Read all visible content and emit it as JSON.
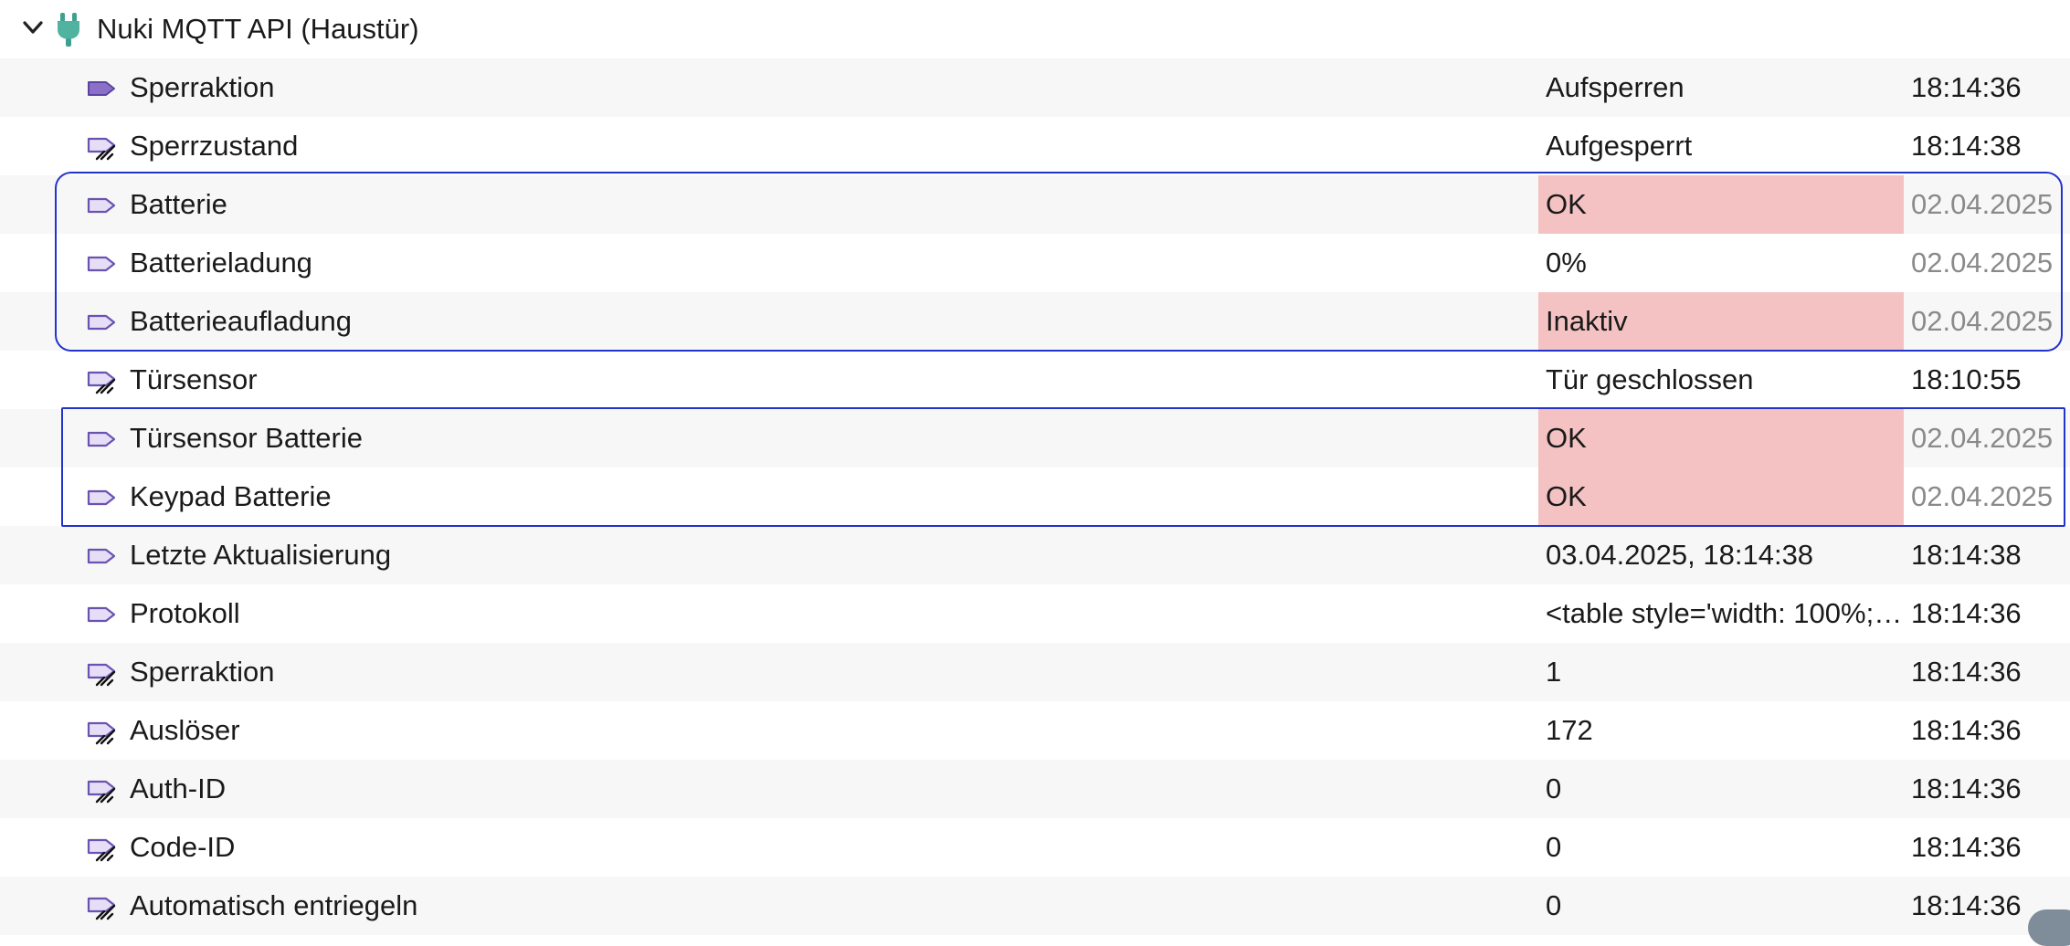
{
  "group": {
    "title": "Nuki MQTT API (Haustür)",
    "expand_icon": "chevron-down-icon",
    "plugin_icon": "plug-icon",
    "plugin_color": "#3fa08f"
  },
  "colors": {
    "row_even": "#f7f7f7",
    "row_odd": "#ffffff",
    "alert_bg": "#f4c2c2",
    "stale_time": "#8a8a8a",
    "highlight_border": "#2233cc",
    "icon_fill": "#8a70c8"
  },
  "rows": [
    {
      "name": "Sperraktion",
      "value": "Aufsperren",
      "time": "18:14:36",
      "icon": "variable-filled-icon",
      "alert": false,
      "stale": false
    },
    {
      "name": "Sperrzustand",
      "value": "Aufgesperrt",
      "time": "18:14:38",
      "icon": "variable-action-icon",
      "alert": false,
      "stale": false
    },
    {
      "name": "Batterie",
      "value": "OK",
      "time": "02.04.2025",
      "icon": "variable-icon",
      "alert": true,
      "stale": true
    },
    {
      "name": "Batterieladung",
      "value": "0%",
      "time": "02.04.2025",
      "icon": "variable-icon",
      "alert": false,
      "stale": true
    },
    {
      "name": "Batterieaufladung",
      "value": "Inaktiv",
      "time": "02.04.2025",
      "icon": "variable-icon",
      "alert": true,
      "stale": true
    },
    {
      "name": "Türsensor",
      "value": "Tür geschlossen",
      "time": "18:10:55",
      "icon": "variable-action-icon",
      "alert": false,
      "stale": false
    },
    {
      "name": "Türsensor Batterie",
      "value": "OK",
      "time": "02.04.2025",
      "icon": "variable-icon",
      "alert": true,
      "stale": true
    },
    {
      "name": "Keypad Batterie",
      "value": "OK",
      "time": "02.04.2025",
      "icon": "variable-icon",
      "alert": true,
      "stale": true
    },
    {
      "name": "Letzte Aktualisierung",
      "value": "03.04.2025, 18:14:38",
      "time": "18:14:38",
      "icon": "variable-icon",
      "alert": false,
      "stale": false
    },
    {
      "name": "Protokoll",
      "value": "<table style='width: 100%;…",
      "time": "18:14:36",
      "icon": "variable-icon",
      "alert": false,
      "stale": false
    },
    {
      "name": "Sperraktion",
      "value": "1",
      "time": "18:14:36",
      "icon": "variable-action-icon",
      "alert": false,
      "stale": false
    },
    {
      "name": "Auslöser",
      "value": "172",
      "time": "18:14:36",
      "icon": "variable-action-icon",
      "alert": false,
      "stale": false
    },
    {
      "name": "Auth-ID",
      "value": "0",
      "time": "18:14:36",
      "icon": "variable-action-icon",
      "alert": false,
      "stale": false
    },
    {
      "name": "Code-ID",
      "value": "0",
      "time": "18:14:36",
      "icon": "variable-action-icon",
      "alert": false,
      "stale": false
    },
    {
      "name": "Automatisch entriegeln",
      "value": "0",
      "time": "18:14:36",
      "icon": "variable-action-icon",
      "alert": false,
      "stale": false
    }
  ]
}
